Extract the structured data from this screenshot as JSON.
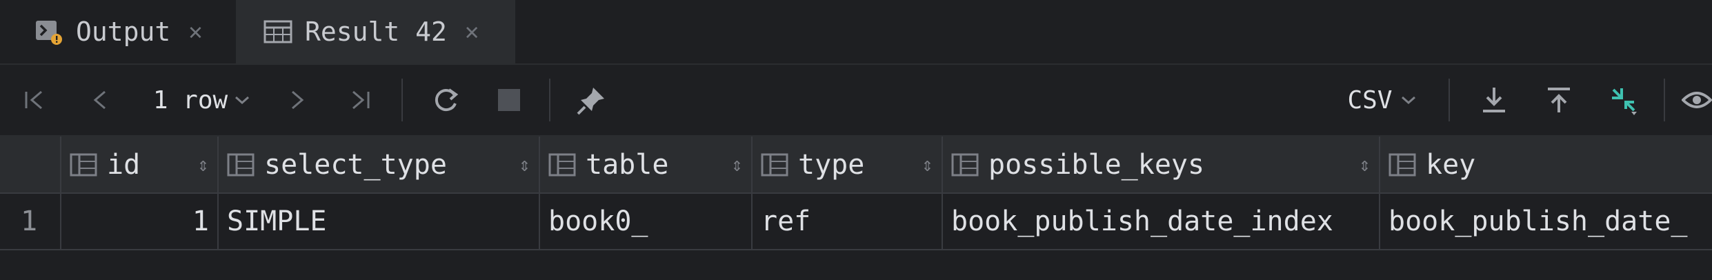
{
  "tabs": [
    {
      "label": "Output",
      "icon": "console-icon",
      "active": false
    },
    {
      "label": "Result 42",
      "icon": "table-icon",
      "active": true
    }
  ],
  "toolbar": {
    "rows_label": "1 row",
    "export_format": "CSV"
  },
  "grid": {
    "columns": [
      "id",
      "select_type",
      "table",
      "type",
      "possible_keys",
      "key"
    ],
    "rows": [
      {
        "row_number": "1",
        "cells": [
          "1",
          "SIMPLE",
          "book0_",
          "ref",
          "book_publish_date_index",
          "book_publish_date_"
        ]
      }
    ]
  },
  "colors": {
    "background": "#1e1f22",
    "header_bg": "#2b2d30",
    "accent_teal": "#3fc1b0"
  }
}
